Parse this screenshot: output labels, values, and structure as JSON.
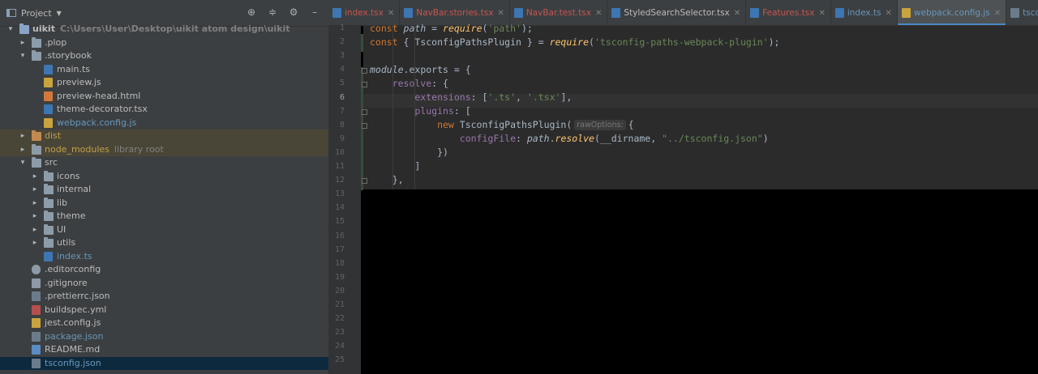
{
  "project_panel": {
    "title": "Project",
    "tree": [
      {
        "label": "uikit",
        "sub": "C:\\Users\\User\\Desktop\\uikit atom design\\uikit",
        "type": "folder",
        "depth": 0,
        "expanded": true,
        "bold": true
      },
      {
        "label": ".plop",
        "type": "folder",
        "depth": 1,
        "expanded": false
      },
      {
        "label": ".storybook",
        "type": "folder",
        "depth": 1,
        "expanded": true
      },
      {
        "label": "main.ts",
        "type": "ts",
        "depth": 2
      },
      {
        "label": "preview.js",
        "type": "js",
        "depth": 2
      },
      {
        "label": "preview-head.html",
        "type": "html",
        "depth": 2
      },
      {
        "label": "theme-decorator.tsx",
        "type": "ts",
        "depth": 2
      },
      {
        "label": "webpack.config.js",
        "type": "js",
        "depth": 2,
        "color": "blue"
      },
      {
        "label": "dist",
        "type": "folder-orange",
        "depth": 1,
        "expanded": false,
        "color": "orange",
        "highlight": true
      },
      {
        "label": "node_modules",
        "sub": "library root",
        "type": "folder",
        "depth": 1,
        "expanded": false,
        "color": "orange",
        "highlight": true
      },
      {
        "label": "src",
        "type": "folder",
        "depth": 1,
        "expanded": true
      },
      {
        "label": "icons",
        "type": "folder",
        "depth": 2,
        "expanded": false
      },
      {
        "label": "internal",
        "type": "folder",
        "depth": 2,
        "expanded": false
      },
      {
        "label": "lib",
        "type": "folder",
        "depth": 2,
        "expanded": false
      },
      {
        "label": "theme",
        "type": "folder",
        "depth": 2,
        "expanded": false
      },
      {
        "label": "UI",
        "type": "folder",
        "depth": 2,
        "expanded": false
      },
      {
        "label": "utils",
        "type": "folder",
        "depth": 2,
        "expanded": false
      },
      {
        "label": "index.ts",
        "type": "ts",
        "depth": 2,
        "color": "blue"
      },
      {
        "label": ".editorconfig",
        "type": "cfg",
        "depth": 1
      },
      {
        "label": ".gitignore",
        "type": "git",
        "depth": 1
      },
      {
        "label": ".prettierrc.json",
        "type": "json",
        "depth": 1
      },
      {
        "label": "buildspec.yml",
        "type": "yml",
        "depth": 1
      },
      {
        "label": "jest.config.js",
        "type": "js",
        "depth": 1
      },
      {
        "label": "package.json",
        "type": "json",
        "depth": 1,
        "color": "blue"
      },
      {
        "label": "README.md",
        "type": "md",
        "depth": 1
      },
      {
        "label": "tsconfig.json",
        "type": "json",
        "depth": 1,
        "color": "blue",
        "selected": true
      }
    ]
  },
  "tabs": [
    {
      "label": "index.tsx",
      "icon": "ts",
      "style": "err"
    },
    {
      "label": "NavBar.stories.tsx",
      "icon": "ts",
      "style": "err"
    },
    {
      "label": "NavBar.test.tsx",
      "icon": "ts",
      "style": "err"
    },
    {
      "label": "StyledSearchSelector.tsx",
      "icon": "ts",
      "style": "plain"
    },
    {
      "label": "Features.tsx",
      "icon": "ts",
      "style": "err"
    },
    {
      "label": "index.ts",
      "icon": "ts",
      "style": "mod"
    },
    {
      "label": "webpack.config.js",
      "icon": "js",
      "style": "mod",
      "active": true
    },
    {
      "label": "tsconfig.json",
      "icon": "json",
      "style": "mod"
    }
  ],
  "editor": {
    "line_count": 25,
    "current_line": 6,
    "code_lines": 12,
    "hint_raw_options": "rawOptions:",
    "lines": {
      "l1": {
        "a": "const ",
        "b": "path",
        "c": " = ",
        "d": "require",
        "e": "(",
        "f": "'path'",
        "g": ");"
      },
      "l2": {
        "a": "const ",
        "b": "{ TsconfigPathsPlugin } = ",
        "c": "require",
        "d": "(",
        "e": "'tsconfig-paths-webpack-plugin'",
        "f": ");"
      },
      "l4": {
        "a": "module",
        "b": ".exports = {"
      },
      "l5": {
        "a": "    resolve",
        "b": ": {"
      },
      "l6": {
        "a": "        extensions",
        "b": ": [",
        "c": "'.ts'",
        "d": ", ",
        "e": "'.tsx'",
        "f": "],"
      },
      "l7": {
        "a": "        plugins",
        "b": ": ["
      },
      "l8": {
        "a": "            new ",
        "b": "TsconfigPathsPlugin(",
        "c": "{"
      },
      "l9": {
        "a": "                configFile",
        "b": ": ",
        "c": "path",
        "d": ".",
        "e": "resolve",
        "f": "(__dirname, ",
        "g": "\"../tsconfig.json\"",
        "h": ")"
      },
      "l10": {
        "a": "            })"
      },
      "l11": {
        "a": "        ]"
      },
      "l12": {
        "a": "    },"
      }
    }
  }
}
